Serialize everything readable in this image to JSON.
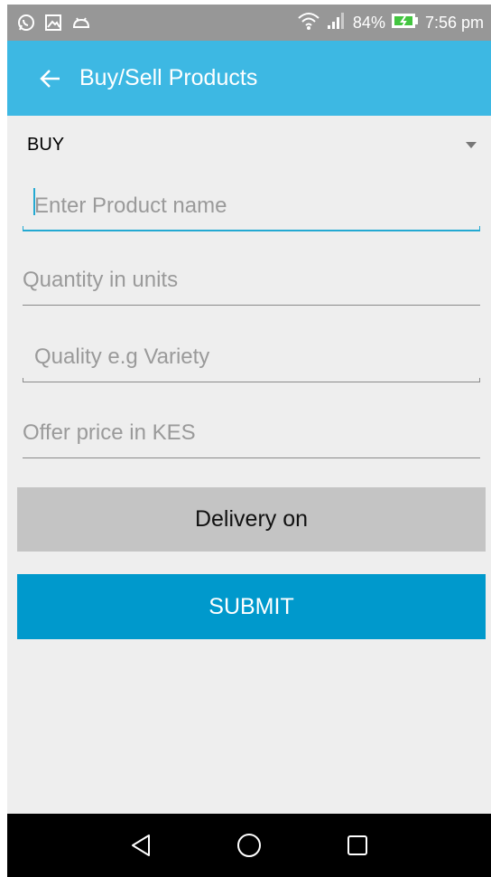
{
  "status_bar": {
    "battery": "84%",
    "time": "7:56 pm",
    "left_icons": [
      "whatsapp-icon",
      "gallery-icon",
      "android-icon"
    ],
    "right_icons": [
      "wifi-icon",
      "signal-icon",
      "battery-charging-icon"
    ]
  },
  "app_bar": {
    "title": "Buy/Sell Products",
    "back_icon": "arrow-left-icon",
    "color": "#3db8e3"
  },
  "form": {
    "type_spinner": {
      "selected": "BUY"
    },
    "fields": [
      {
        "placeholder": "Enter Product name",
        "value": "",
        "focused": true
      },
      {
        "placeholder": "Quantity in units",
        "value": ""
      },
      {
        "placeholder": "Quality e.g Variety",
        "value": ""
      },
      {
        "placeholder": "Offer price in KES",
        "value": ""
      }
    ],
    "delivery_button": "Delivery on",
    "submit_button": "SUBMIT"
  },
  "nav_bar": {
    "icons": [
      "back-triangle-icon",
      "home-circle-icon",
      "recents-square-icon"
    ]
  },
  "colors": {
    "accent": "#0099cc",
    "focus_line": "#23a9d2",
    "status_bar": "#979797",
    "background": "#eeeeee"
  }
}
